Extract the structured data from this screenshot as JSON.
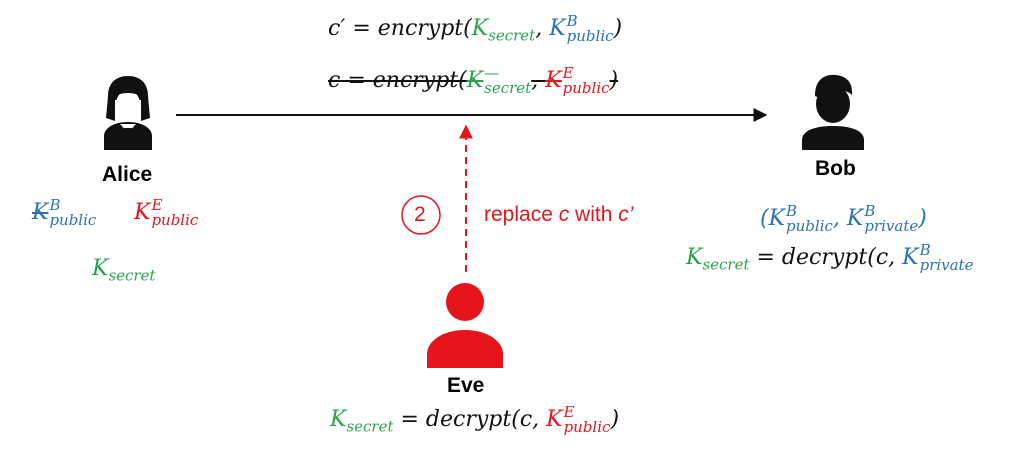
{
  "colors": {
    "green": "#2ca24a",
    "blue": "#2a72b5",
    "red": "#e8141b",
    "black": "#111111"
  },
  "icons": {
    "alice": "female-person-icon",
    "bob": "male-person-icon",
    "eve": "person-icon"
  },
  "top": {
    "eq1": {
      "lhs": "c′",
      "eq": " = ",
      "fn": "encrypt(",
      "k1": "K",
      "k1_sub": "secret",
      "comma": ", ",
      "k2": "K",
      "k2_sup": "B",
      "k2_sub": "public",
      "close": ")"
    },
    "eq2": {
      "lhs": "c",
      "eq": " = ",
      "fn": "encrypt(",
      "k1": "K",
      "k1_sup": "—",
      "k1_sub": "secret",
      "comma": ", ",
      "k2": "K",
      "k2_sup": "E",
      "k2_sub": "public",
      "close": ")"
    }
  },
  "alice": {
    "name": "Alice",
    "old_key": {
      "k": "K",
      "sup": "B",
      "sub": "public"
    },
    "new_key": {
      "k": "K",
      "sup": "E",
      "sub": "public"
    },
    "secret": {
      "k": "K",
      "sub": "secret"
    }
  },
  "bob": {
    "name": "Bob",
    "keypair": {
      "open": "(",
      "k1": "K",
      "k1_sup": "B",
      "k1_sub": "public",
      "comma": ", ",
      "k2": "K",
      "k2_sup": "B",
      "k2_sub": "private",
      "close": ")"
    },
    "decrypt": {
      "k": "K",
      "k_sub": "secret",
      "eq": " = ",
      "fn": "decrypt(",
      "c": "c, ",
      "k2": "K",
      "k2_sup": "B",
      "k2_sub": "private"
    }
  },
  "eve": {
    "name": "Eve",
    "step_number": "2",
    "step_pre": "replace ",
    "step_c": "c",
    "step_mid": " with ",
    "step_c2": "c’",
    "decrypt": {
      "k": "K",
      "k_sub": "secret",
      "eq": " = ",
      "fn": "decrypt(",
      "c": "c, ",
      "k2": "K",
      "k2_sup": "E",
      "k2_sub": "public",
      "close": ")"
    }
  }
}
